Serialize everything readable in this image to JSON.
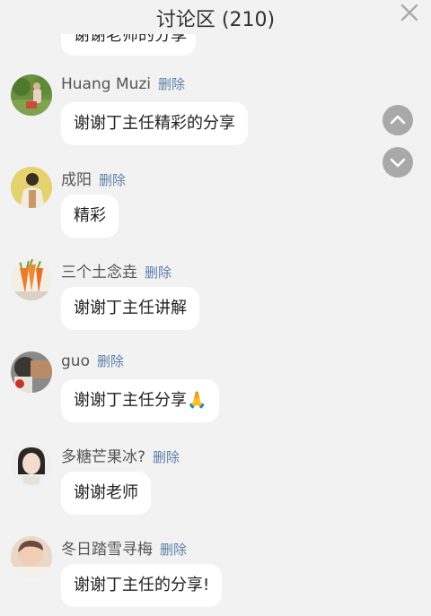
{
  "header": {
    "title": "讨论区 (210)"
  },
  "partial_comment": {
    "text": "谢谢老师的分享"
  },
  "comments": [
    {
      "username": "Huang Muzi",
      "delete_label": "删除",
      "text": "谢谢丁主任精彩的分享",
      "avatar_icon": "garden-photo-avatar"
    },
    {
      "username": "成阳",
      "delete_label": "删除",
      "text": "精彩",
      "avatar_icon": "person-photo-avatar"
    },
    {
      "username": "三个土念垚",
      "delete_label": "删除",
      "text": "谢谢丁主任讲解",
      "avatar_icon": "carrots-avatar"
    },
    {
      "username": "guo",
      "delete_label": "删除",
      "text": "谢谢丁主任分享🙏",
      "avatar_icon": "photo-avatar"
    },
    {
      "username": "多糖芒果冰?",
      "delete_label": "删除",
      "text": "谢谢老师",
      "avatar_icon": "woman-photo-avatar"
    },
    {
      "username": "冬日踏雪寻梅",
      "delete_label": "删除",
      "text": "谢谢丁主任的分享!",
      "avatar_icon": "baby-photo-avatar"
    }
  ],
  "controls": {
    "close_icon": "close-icon",
    "scroll_up_icon": "chevron-up-icon",
    "scroll_down_icon": "chevron-down-icon"
  },
  "colors": {
    "background": "#f2f2f2",
    "bubble": "#ffffff",
    "delete_link": "#5b7fa8",
    "scroll_button": "#a9a9a9"
  }
}
